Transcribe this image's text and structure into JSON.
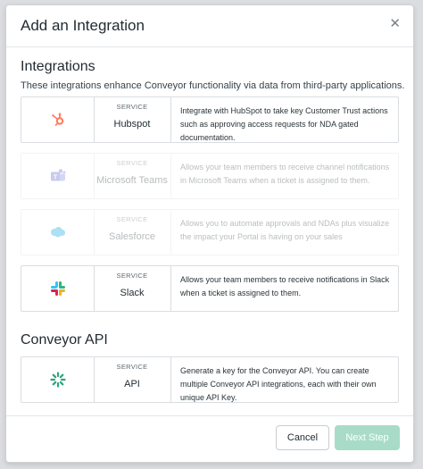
{
  "modal": {
    "title": "Add an Integration",
    "close_glyph": "✕"
  },
  "integrations_section": {
    "title": "Integrations",
    "description": "These integrations enhance Conveyor functionality via data from third-party applications."
  },
  "service_label": "SERVICE",
  "integrations": [
    {
      "name": "Hubspot",
      "icon": "hubspot-icon",
      "enabled": true,
      "description": "Integrate with HubSpot to take key Customer Trust actions such as approving access requests for NDA gated documentation."
    },
    {
      "name": "Microsoft Teams",
      "icon": "microsoft-teams-icon",
      "enabled": false,
      "description": "Allows your team members to receive channel notifications in Microsoft Teams when a ticket is assigned to them."
    },
    {
      "name": "Salesforce",
      "icon": "salesforce-icon",
      "enabled": false,
      "description": "Allows you to automate approvals and NDAs plus visualize the impact your Portal is having on your sales"
    },
    {
      "name": "Slack",
      "icon": "slack-icon",
      "enabled": true,
      "description": "Allows your team members to receive notifications in Slack when a ticket is assigned to them."
    }
  ],
  "api_section": {
    "title": "Conveyor API",
    "service_name": "API",
    "icon": "conveyor-api-icon",
    "description": "Generate a key for the Conveyor API. You can create multiple Conveyor API integrations, each with their own unique API Key."
  },
  "footer": {
    "cancel_label": "Cancel",
    "next_label": "Next Step"
  },
  "colors": {
    "hubspot": "#ff7a59",
    "teams": "#5b5fc7",
    "salesforce": "#00a1e0",
    "conveyor_green": "#2fa37c",
    "next_button": "#a8dcc8"
  }
}
